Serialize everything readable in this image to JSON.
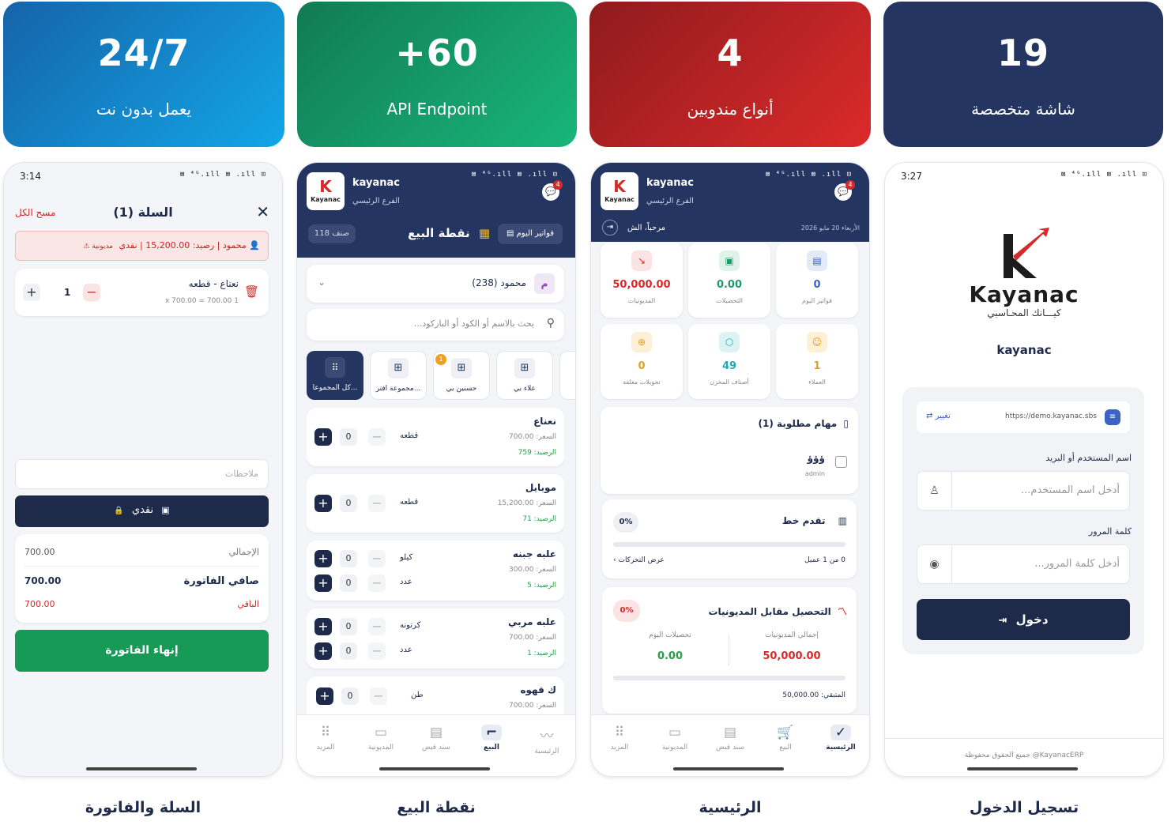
{
  "stats": [
    {
      "value": "24/7",
      "label": "يعمل بدون نت"
    },
    {
      "value": "+60",
      "label": "API Endpoint"
    },
    {
      "value": "4",
      "label": "أنواع مندوبين"
    },
    {
      "value": "19",
      "label": "شاشة متخصصة"
    }
  ],
  "captions": [
    "السلة والفاتورة",
    "نقطة البيع",
    "الرئيسية",
    "تسجيل الدخول"
  ],
  "status_icons": "⊠ ⁴ᴳ.ıll ⊠ .ıll ⊡",
  "cart": {
    "time": "3:14",
    "title": "السلة (1)",
    "clear": "مسح الكل",
    "customer": "محمود | رصيد: 15,200.00 | نقدي",
    "debt_tag": "مديونية ⚠",
    "item_name": "نعناع - قطعه",
    "item_calc": "1 x 700.00 = 700.00",
    "qty": "1",
    "notes_placeholder": "ملاحظات",
    "pay_method": "نقدي",
    "total_label": "الإجمالي",
    "total_value": "700.00",
    "net_label": "صافي الفاتورة",
    "net_value": "700.00",
    "remain_label": "الباقي",
    "remain_value": "700.00",
    "finish": "إنهاء الفاتورة"
  },
  "pos": {
    "brand": "kayanac",
    "branch": "الفرع الرئيسي",
    "badge": "4",
    "title": "نقطة البيع",
    "count": "118 صنف",
    "invoices_btn": "فواتير اليوم",
    "customer_avatar": "م",
    "customer": "محمود (238)",
    "search_placeholder": "بحث بالاسم أو الكود أو الباركود...",
    "groups": [
      {
        "label": "كل المجموعا...",
        "badge": ""
      },
      {
        "label": "مجموعة افتر...",
        "badge": ""
      },
      {
        "label": "حسنين بي",
        "badge": "1"
      },
      {
        "label": "علاء بي",
        "badge": ""
      }
    ],
    "products": [
      {
        "name": "نعناع",
        "price": "السعر: 700.00",
        "stock": "الرصيد: 759",
        "units": [
          {
            "unit": "قطعه",
            "qty": "0"
          }
        ]
      },
      {
        "name": "موبايل",
        "price": "السعر: 15,200.00",
        "stock": "الرصيد: 71",
        "units": [
          {
            "unit": "قطعه",
            "qty": "0"
          }
        ]
      },
      {
        "name": "علبه جبنه",
        "price": "السعر: 300.00",
        "stock": "الرصيد: 5",
        "units": [
          {
            "unit": "كيلو",
            "qty": "0"
          },
          {
            "unit": "عدد",
            "qty": "0"
          }
        ]
      },
      {
        "name": "علبه مربي",
        "price": "السعر: 700.00",
        "stock": "الرصيد: 1",
        "units": [
          {
            "unit": "كرتونه",
            "qty": "0"
          },
          {
            "unit": "عدد",
            "qty": "0"
          }
        ]
      },
      {
        "name": "ك قهوه",
        "price": "السعر: 700.00",
        "stock": "",
        "units": [
          {
            "unit": "طن",
            "qty": "0"
          }
        ]
      }
    ],
    "nav": [
      "الرئيسية",
      "البيع",
      "سند قبض",
      "المديونية",
      "المزيد"
    ]
  },
  "home": {
    "brand": "kayanac",
    "branch": "الفرع الرئيسي",
    "badge": "4",
    "greeting": "مرحباً، الش",
    "date": "الأربعاء 20 مايو 2026",
    "tiles": [
      {
        "value": "0",
        "label": "فواتير اليوم",
        "color": "#3b62c4"
      },
      {
        "value": "0.00",
        "label": "التحصيلات",
        "color": "#1e9a6a"
      },
      {
        "value": "50,000.00",
        "label": "المديونيات",
        "color": "#d42a2a"
      },
      {
        "value": "1",
        "label": "العملاء",
        "color": "#e2a11b"
      },
      {
        "value": "49",
        "label": "أصناف المخزن",
        "color": "#1ca9b8"
      },
      {
        "value": "0",
        "label": "تحويلات معلقة",
        "color": "#e2a11b"
      }
    ],
    "tasks_title": "مهام مطلوبة (1)",
    "task_name": "ؤؤؤ",
    "task_user": "admin",
    "route_title": "تقدم خط",
    "route_pct": "0%",
    "route_progress": 0,
    "route_count": "0 من 1 عميل",
    "route_link": "عرض التحركات",
    "coll_title": "التحصيل مقابل المديونيات",
    "coll_pct": "0%",
    "coll_progress": 0,
    "debt_label": "إجمالي المديونيات",
    "debt_value": "50,000.00",
    "today_label": "تحصيلات اليوم",
    "today_value": "0.00",
    "remaining": "المتبقي: 50,000.00",
    "nav": [
      "الرئيسية",
      "البيع",
      "سند قبض",
      "المديونية",
      "المزيد"
    ]
  },
  "login": {
    "time": "3:27",
    "logo_word": "Kayanac",
    "logo_ar": "كيـــانك المحـاسبي",
    "app_name": "kayanac",
    "server": "https://demo.kayanac.sbs",
    "change": "تغيير",
    "user_label": "اسم المستخدم أو البريد",
    "user_placeholder": "أدخل اسم المستخدم...",
    "pass_label": "كلمة المرور",
    "pass_placeholder": "أدخل كلمة المرور...",
    "login_btn": "دخول",
    "footer": "جميع الحقوق محفوظة @KayanacERP"
  }
}
